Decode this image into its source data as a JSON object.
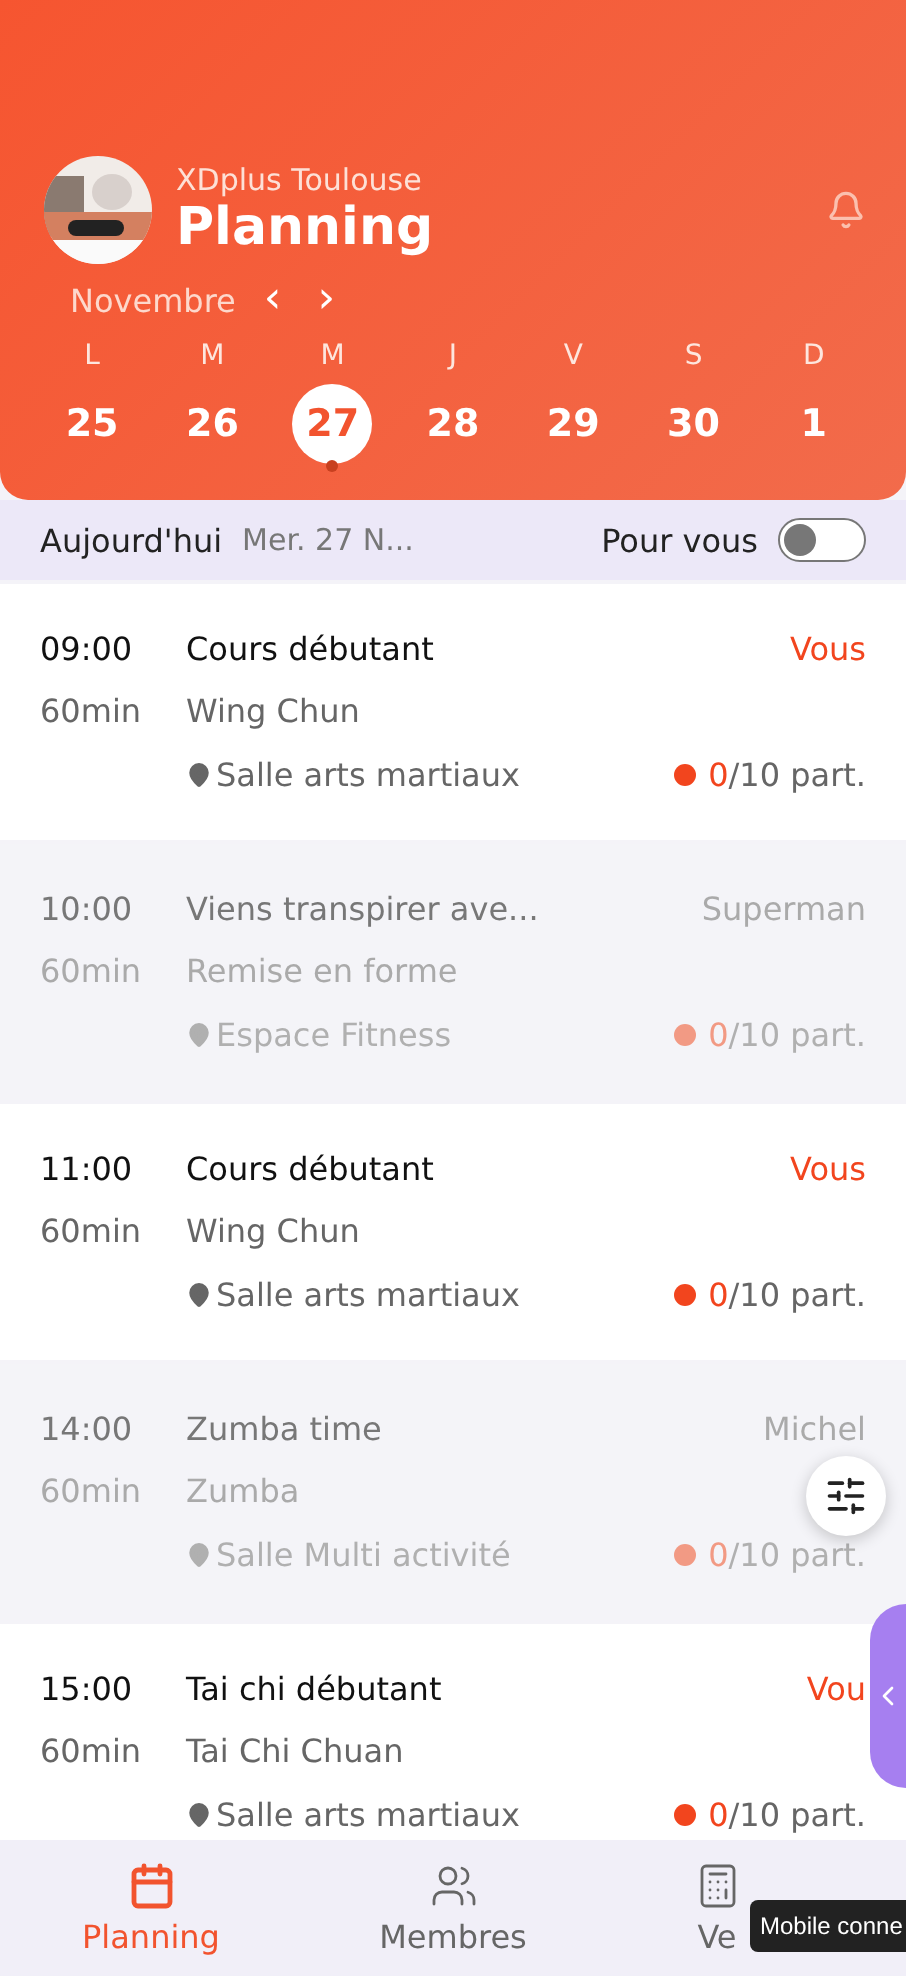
{
  "header": {
    "club": "XDplus Toulouse",
    "title": "Planning",
    "month": "Novembre",
    "prev": "‹",
    "next": "›"
  },
  "week": [
    {
      "letter": "L",
      "day": "25",
      "selected": false
    },
    {
      "letter": "M",
      "day": "26",
      "selected": false
    },
    {
      "letter": "M",
      "day": "27",
      "selected": true
    },
    {
      "letter": "J",
      "day": "28",
      "selected": false
    },
    {
      "letter": "V",
      "day": "29",
      "selected": false
    },
    {
      "letter": "S",
      "day": "30",
      "selected": false
    },
    {
      "letter": "D",
      "day": "1",
      "selected": false
    }
  ],
  "daybar": {
    "today": "Aujourd'hui",
    "date": "Mer. 27 N...",
    "filter_label": "Pour vous",
    "filter_on": false
  },
  "sessions": [
    {
      "time": "09:00",
      "duration": "60min",
      "title": "Cours débutant",
      "activity": "Wing Chun",
      "coach": "Vous",
      "room": "Salle arts martiaux",
      "booked": "0",
      "capacity": "/10 part.",
      "faded": false
    },
    {
      "time": "10:00",
      "duration": "60min",
      "title": "Viens transpirer ave...",
      "activity": "Remise en forme",
      "coach": "Superman",
      "room": "Espace Fitness",
      "booked": "0",
      "capacity": "/10 part.",
      "faded": true
    },
    {
      "time": "11:00",
      "duration": "60min",
      "title": "Cours débutant",
      "activity": "Wing Chun",
      "coach": "Vous",
      "room": "Salle arts martiaux",
      "booked": "0",
      "capacity": "/10 part.",
      "faded": false
    },
    {
      "time": "14:00",
      "duration": "60min",
      "title": "Zumba time",
      "activity": "Zumba",
      "coach": "Michel",
      "room": "Salle Multi activité",
      "booked": "0",
      "capacity": "/10 part.",
      "faded": true
    },
    {
      "time": "15:00",
      "duration": "60min",
      "title": "Tai chi débutant",
      "activity": "Tai Chi Chuan",
      "coach": "Vou",
      "room": "Salle arts martiaux",
      "booked": "0",
      "capacity": "/10 part.",
      "faded": false
    }
  ],
  "nav": [
    {
      "label": "Planning",
      "kind": "calendar",
      "selected": true
    },
    {
      "label": "Membres",
      "kind": "members",
      "selected": false
    },
    {
      "label": "Ve",
      "kind": "register",
      "selected": false
    }
  ],
  "tooltip": "Mobile conne"
}
